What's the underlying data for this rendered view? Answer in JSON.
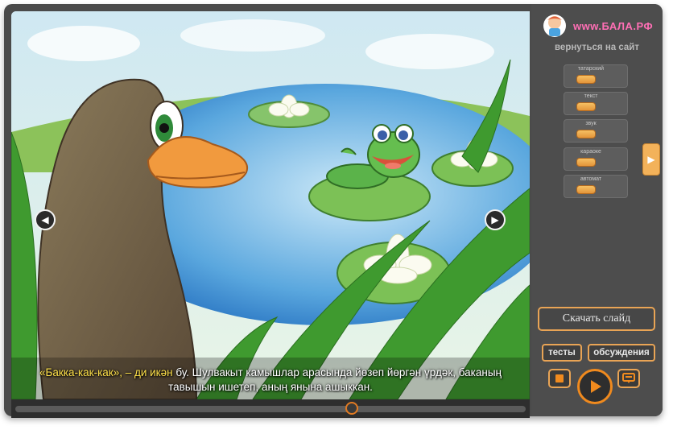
{
  "slide": {
    "caption_highlight": "«Бакка-как-как», – ди икән",
    "caption_rest_line1": " бу. Шулвакыт камышлар арасында йөзеп йөргән үрдәк, баканың",
    "caption_line2": "тавышын ишетеп, аның янына ашыккан.",
    "progress": 0.66
  },
  "sidebar": {
    "logo_text": "www.БАЛА.РФ",
    "back_link": "вернуться на сайт",
    "toggles": [
      {
        "label": "татарский"
      },
      {
        "label": "текст"
      },
      {
        "label": "звук"
      },
      {
        "label": "караоке"
      },
      {
        "label": "автомат"
      }
    ],
    "download_label": "Скачать слайд",
    "tests_label": "тесты",
    "discussion_label": "обсуждения"
  },
  "colors": {
    "accent": "#f08a1e",
    "panel": "#4d4d4d",
    "caption_highlight": "#ffe14a"
  },
  "icons": {
    "prev": "chevron-left-icon",
    "next": "chevron-right-icon",
    "stop": "stop-icon",
    "play": "play-icon",
    "subtitles": "subtitles-icon",
    "side_tab": "chevron-right-icon"
  }
}
